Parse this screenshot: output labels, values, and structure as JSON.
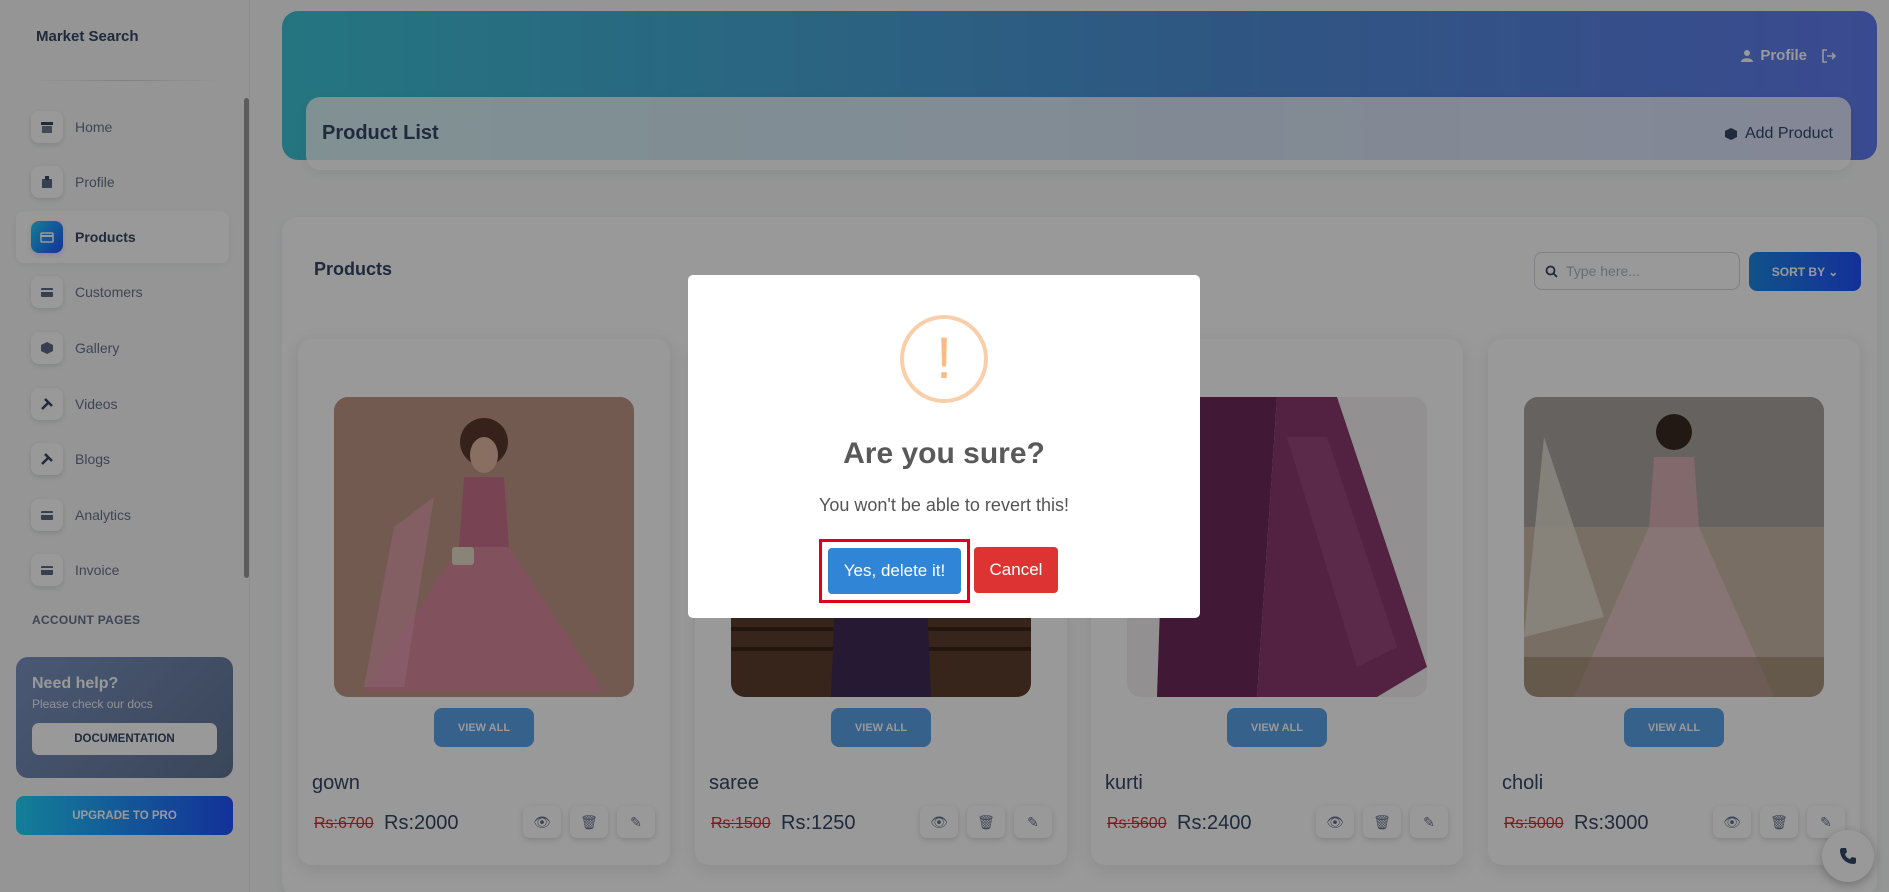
{
  "sidebar": {
    "brand": "Market Search",
    "items": [
      {
        "label": "Home",
        "icon": "store-icon"
      },
      {
        "label": "Profile",
        "icon": "building-icon"
      },
      {
        "label": "Products",
        "icon": "card-icon",
        "active": true
      },
      {
        "label": "Customers",
        "icon": "card-icon"
      },
      {
        "label": "Gallery",
        "icon": "box-icon"
      },
      {
        "label": "Videos",
        "icon": "tools-icon"
      },
      {
        "label": "Blogs",
        "icon": "tools-icon"
      },
      {
        "label": "Analytics",
        "icon": "card-icon"
      },
      {
        "label": "Invoice",
        "icon": "card-icon"
      }
    ],
    "section_heading": "ACCOUNT PAGES",
    "help": {
      "title": "Need help?",
      "subtitle": "Please check our docs",
      "button": "DOCUMENTATION"
    },
    "upgrade_button": "UPGRADE TO PRO"
  },
  "header": {
    "profile_link": "Profile",
    "page_title": "Product List",
    "add_product": "Add Product"
  },
  "main": {
    "heading": "Products",
    "search_placeholder": "Type here...",
    "sort_button": "SORT BY",
    "products": [
      {
        "name": "gown",
        "old_price": "Rs:6700",
        "price": "Rs:2000",
        "view_all": "VIEW ALL"
      },
      {
        "name": "saree",
        "old_price": "Rs:1500",
        "price": "Rs:1250",
        "view_all": "VIEW ALL"
      },
      {
        "name": "kurti",
        "old_price": "Rs:5600",
        "price": "Rs:2400",
        "view_all": "VIEW ALL"
      },
      {
        "name": "choli",
        "old_price": "Rs:5000",
        "price": "Rs:3000",
        "view_all": "VIEW ALL"
      }
    ]
  },
  "dialog": {
    "icon_symbol": "!",
    "title": "Are you sure?",
    "text": "You won't be able to revert this!",
    "confirm": "Yes, delete it!",
    "cancel": "Cancel"
  },
  "colors": {
    "header_gradient_start": "#3ec4d7",
    "header_gradient_end": "#627cf0",
    "confirm": "#3085d6",
    "cancel": "#dd3333",
    "highlight": "#e0001a",
    "old_price": "#d32f2f"
  }
}
